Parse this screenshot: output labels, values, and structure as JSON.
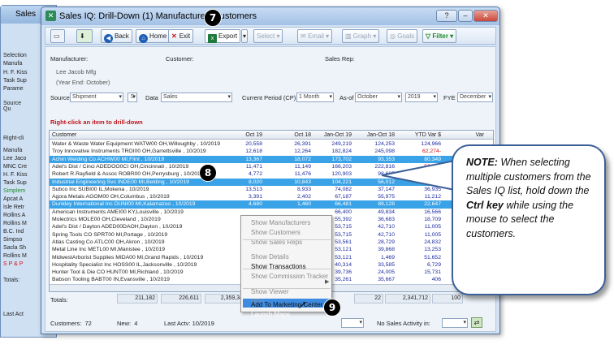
{
  "background_window": {
    "title": "Sales",
    "labels": [
      "Selection",
      "Manufa",
      "H. F. Kiss",
      "Task Sup",
      "Parame",
      "Source",
      "Qu",
      "Right-cli",
      "Manufa",
      "Lee Jaco",
      "MNC Cre",
      "H. F. Kiss",
      "Task Sup",
      "Simplem",
      "Apcat A",
      "Isle Retr",
      "Rollins A",
      "Rollins M",
      "B.C. Ind",
      "Simpso",
      "Sacla Sh",
      "Rollins M",
      "S P & P",
      "Totals:",
      "Last Act"
    ]
  },
  "window": {
    "title": "Sales IQ: Drill-Down (1) Manufacturer>Customers",
    "controls": {
      "help": "?",
      "min": "–",
      "close": "✕"
    }
  },
  "toolbar": {
    "back": "Back",
    "home": "Home",
    "exit": "Exit",
    "export": "Export",
    "select": "Select",
    "email": "Email",
    "graph": "Graph",
    "goals": "Goals",
    "filter": "Filter"
  },
  "header": {
    "manufacturer_label": "Manufacturer:",
    "customer_label": "Customer:",
    "sales_rep_label": "Sales Rep:",
    "manufacturer_name": "Lee Jacob Mfg",
    "year_end": "(Year End: October)"
  },
  "filters": {
    "source_label": "Source",
    "source_value": "Shipment",
    "s_button": "S",
    "data_label": "Data",
    "data_value": "Sales",
    "period_label": "Current Period (CP)",
    "period_value": "1 Month",
    "asof_label": "As-of",
    "asof_month": "October",
    "asof_year": "2019",
    "fye_label": "FYE",
    "fye_value": "December"
  },
  "hint": "Right-click an item to drill-down",
  "columns": [
    "Customer",
    "Oct 19",
    "Oct 18",
    "Jan-Oct 19",
    "Jan-Oct 18",
    "YTD Var $",
    "Var"
  ],
  "rows": [
    {
      "name": "Water & Waste Water Equipment  WATW00  OH,Willoughby , 10/2019",
      "v": [
        "20,558",
        "26,391",
        "249,219",
        "124,253",
        "124,966"
      ],
      "sel": false
    },
    {
      "name": "Troy Innovative Instruments  TROI00  OH,Garrettsville , 10/2019",
      "v": [
        "12,618",
        "12,264",
        "182,824",
        "245,098",
        "62,274-"
      ],
      "sel": false
    },
    {
      "name": "Achin Welding Co  ACHW00  MI,Flint , 10/2019",
      "v": [
        "13,367",
        "18,072",
        "173,702",
        "93,353",
        "80,349"
      ],
      "sel": true
    },
    {
      "name": "Adel's Dist / Cinci  ADEDOO0CI OH,Cincinnati , 10/2019",
      "v": [
        "11,471",
        "11,149",
        "166,203",
        "222,816",
        "56,613"
      ],
      "sel": false
    },
    {
      "name": "Robert R.Rayfield & Assoc  ROBR00  OH,Perrysburg , 10/2019",
      "v": [
        "4,772",
        "11,476",
        "120,903",
        "98,685",
        "22,218"
      ],
      "sel": false
    },
    {
      "name": "Industrial Engineering Svc  INDE00  MI,Belding , 10/2019",
      "v": [
        "8,020",
        "10,843",
        "104,221",
        "56,012",
        "48,209"
      ],
      "sel": true
    },
    {
      "name": "Subco Inc  SUBI00  IL,Mokena , 10/2019",
      "v": [
        "13,513",
        "8,933",
        "74,082",
        "37,147",
        "36,935"
      ],
      "sel": false
    },
    {
      "name": "Agora Metals  AGOM00  OH,Columbus , 10/2019",
      "v": [
        "3,391",
        "2,402",
        "67,187",
        "55,975",
        "11,212"
      ],
      "sel": false
    },
    {
      "name": "Dunkley International Inc  DUNI00  MI,Kalamazoo , 10/2019",
      "v": [
        "4,680",
        "1,460",
        "66,481",
        "89,128",
        "22,647"
      ],
      "sel": true
    },
    {
      "name": "American Instruments  AMEI00  KY,Louisville , 10/2019",
      "v": [
        "",
        "",
        "66,400",
        "49,834",
        "16,566"
      ],
      "sel": false
    },
    {
      "name": "Molectrics  MOLE00  OH,Cleveland , 10/2019",
      "v": [
        "",
        "",
        "55,392",
        "36,683",
        "18,709"
      ],
      "sel": false
    },
    {
      "name": "Adel's Dist / Dayton  ADED00DAOH,Dayton , 10/2019",
      "v": [
        "",
        "",
        "53,715",
        "42,710",
        "11,005"
      ],
      "sel": false
    },
    {
      "name": "Spring Tools CO  SPRT00  MI,Portage , 10/2019",
      "v": [
        "",
        "",
        "53,715",
        "42,710",
        "11,005"
      ],
      "sel": false
    },
    {
      "name": "Atlas Casting Co  ATLC00  OH,Akron , 10/2019",
      "v": [
        "",
        "",
        "53,561",
        "28,729",
        "24,832"
      ],
      "sel": false
    },
    {
      "name": "Metal Line Inc  METL00  MI,Manistee , 10/2019",
      "v": [
        "",
        "",
        "53,121",
        "39,868",
        "13,253"
      ],
      "sel": false
    },
    {
      "name": "MidwestArborist Supplies  MIDA00  MI,Grand Rapids , 10/2019",
      "v": [
        "",
        "",
        "53,121",
        "1,469",
        "51,652"
      ],
      "sel": false
    },
    {
      "name": "Hospitality Specialist Inc  HOSS00  IL,Jacksonville , 10/2019",
      "v": [
        "",
        "",
        "40,314",
        "33,585",
        "6,729"
      ],
      "sel": false
    },
    {
      "name": "Hunter Tool & Die CO  HUNT00  MI,Richland , 10/2019",
      "v": [
        "",
        "",
        "39,736",
        "24,005",
        "15,731"
      ],
      "sel": false
    },
    {
      "name": "Babson Tooling  BABT00  IN,Evansville , 10/2019",
      "v": [
        "",
        "",
        "35,261",
        "35,667",
        "406"
      ],
      "sel": false
    }
  ],
  "totals": {
    "label": "Totals:",
    "values": [
      "211,182",
      "226,611",
      "2,359,34",
      "22",
      "2,341,712",
      "100"
    ]
  },
  "footer": {
    "customers_label": "Customers:",
    "customers_value": "72",
    "new_label": "New:",
    "new_value": "4",
    "last_actv_label": "Last Actv:",
    "last_actv_value": "10/2019",
    "last_activity_label": "Last Activity:",
    "no_sales_label": "No Sales Activity in:"
  },
  "context_menu": [
    {
      "label": "Show Manufacturers",
      "enabled": false
    },
    {
      "label": "Show Customers",
      "enabled": false
    },
    {
      "label": "Show Sales Reps",
      "enabled": false
    },
    {
      "label": "Show Details",
      "enabled": false
    },
    {
      "label": "Show Transactions",
      "enabled": true
    },
    {
      "label": "Show Commission Tracker",
      "enabled": false
    },
    {
      "label": "Show Viewer",
      "enabled": false
    },
    {
      "label": "cRm",
      "enabled": false
    },
    {
      "label": "Add To Marketing Center",
      "enabled": true
    },
    {
      "label": "Launch Maps",
      "enabled": true
    }
  ],
  "callouts": {
    "seven": "7",
    "eight": "8",
    "nine": "9"
  },
  "note": {
    "title": "NOTE:",
    "text1": "When selecting multiple customers from the Sales IQ list, hold down the",
    "key": "Ctrl key",
    "text2": "while using the mouse to select the customers."
  },
  "colors": {
    "selection": "#3aa2e6",
    "value_text": "#1b2a9e",
    "negative": "#d01010",
    "hint": "#c0141b",
    "note_border": "#3a5f97"
  }
}
